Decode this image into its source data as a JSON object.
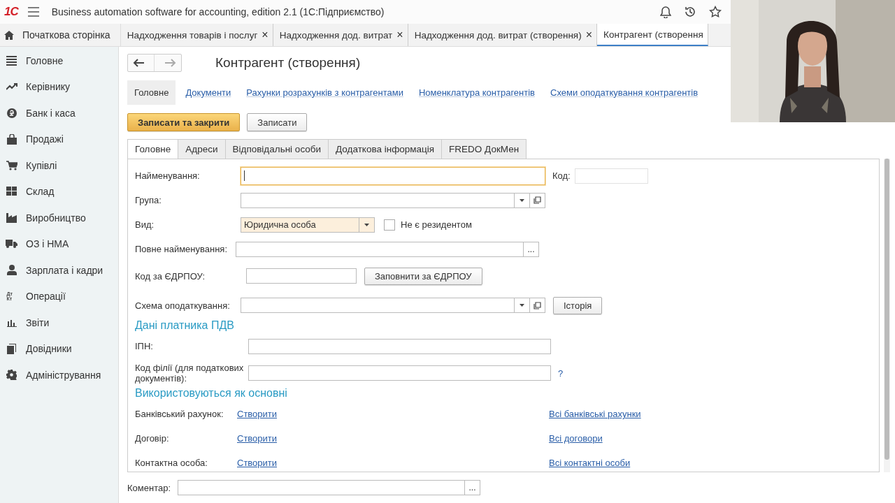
{
  "app": {
    "logo": "1С",
    "title": "Business automation software for accounting, edition 2.1  (1С:Підприємство)"
  },
  "home_tab": {
    "label": "Початкова сторінка"
  },
  "tabs": [
    {
      "label": "Надходження товарів і послуг",
      "close": "×",
      "selected": false
    },
    {
      "label": "Надходження дод. витрат",
      "close": "×",
      "selected": false
    },
    {
      "label": "Надходження дод. витрат (створення)",
      "close": "×",
      "selected": false
    },
    {
      "label": "Контрагент (створення",
      "selected": true
    }
  ],
  "sidebar": {
    "items": [
      {
        "label": "Головне"
      },
      {
        "label": "Керівнику"
      },
      {
        "label": "Банк і каса"
      },
      {
        "label": "Продажі"
      },
      {
        "label": "Купівлі"
      },
      {
        "label": "Склад"
      },
      {
        "label": "Виробництво"
      },
      {
        "label": "ОЗ і НМА"
      },
      {
        "label": "Зарплата і кадри"
      },
      {
        "label": "Операції",
        "icon_text": "Дт Кт"
      },
      {
        "label": "Звіти"
      },
      {
        "label": "Довідники"
      },
      {
        "label": "Адміністрування"
      }
    ]
  },
  "form": {
    "title": "Контрагент (створення)",
    "sections": [
      {
        "label": "Головне",
        "selected": true
      },
      {
        "label": "Документи",
        "selected": false
      },
      {
        "label": "Рахунки розрахунків з контрагентами",
        "selected": false
      },
      {
        "label": "Номенклатура контрагентів",
        "selected": false
      },
      {
        "label": "Схеми оподаткування контрагентів",
        "selected": false
      }
    ],
    "buttons": [
      {
        "label": "Записати та закрити",
        "kind": "primary"
      },
      {
        "label": "Записати",
        "kind": "normal"
      }
    ],
    "tabs": [
      {
        "label": "Головне",
        "selected": true
      },
      {
        "label": "Адреси",
        "selected": false
      },
      {
        "label": "Відповідальні особи",
        "selected": false
      },
      {
        "label": "Додаткова інформація",
        "selected": false
      },
      {
        "label": "FREDO ДокМен",
        "selected": false
      }
    ],
    "name": {
      "label": "Найменування:",
      "focused": true
    },
    "code": {
      "label": "Код:"
    },
    "group": {
      "label": "Група:"
    },
    "kind": {
      "label": "Вид:",
      "value": "Юридична особа"
    },
    "non_resident": {
      "label": "Не є резидентом",
      "checked": false
    },
    "full_name": {
      "label": "Повне найменування:",
      "button": "..."
    },
    "edrpou": {
      "label": "Код за ЄДРПОУ:",
      "button": "Заповнити за ЄДРПОУ"
    },
    "tax_scheme": {
      "label": "Схема оподаткування:",
      "button": "Історія"
    },
    "vat_heading": "Дані платника ПДВ",
    "ipn": {
      "label": "ІПН:"
    },
    "branch": {
      "label": "Код філії (для податкових документів):",
      "help": "?"
    },
    "defaults_heading": "Використовуються як основні",
    "defaults": [
      {
        "label": "Банківський рахунок:",
        "link": "Створити",
        "all": "Всі банківські рахунки"
      },
      {
        "label": "Договір:",
        "link": "Створити",
        "all": "Всі договори"
      },
      {
        "label": "Контактна особа:",
        "link": "Створити",
        "all": "Всі контактні особи"
      }
    ],
    "comment": {
      "label": "Коментар:",
      "button": "..."
    }
  }
}
